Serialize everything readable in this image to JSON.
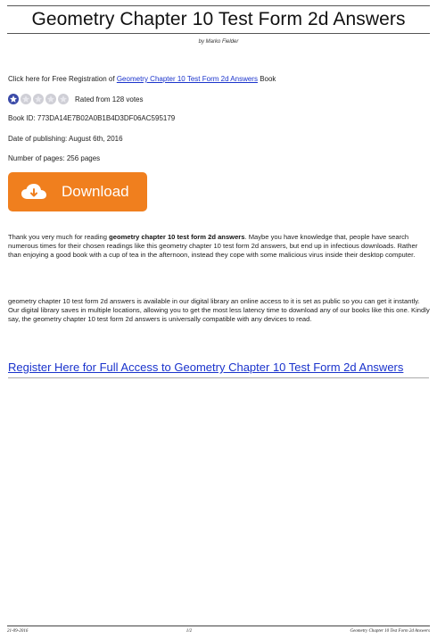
{
  "header": {
    "title": "Geometry Chapter 10 Test Form 2d Answers",
    "byline": "by Marko Fielder"
  },
  "registration": {
    "prefix": "Click here for Free Registration of ",
    "link_text": "Geometry Chapter 10 Test Form 2d Answers",
    "suffix": " Book"
  },
  "rating": {
    "stars_filled": 1,
    "stars_total": 5,
    "text": "Rated from 128 votes"
  },
  "meta": {
    "book_id": "Book ID: 773DA14E7B02A0B1B4D3DF06AC595179",
    "published": "Date of publishing: August 6th, 2016",
    "pages": "Number of pages: 256 pages"
  },
  "download": {
    "label": "Download"
  },
  "body": {
    "p1_prefix": "Thank you very much for reading ",
    "p1_bold": "geometry chapter 10 test form 2d answers",
    "p1_rest": ". Maybe you have knowledge that, people have search numerous times for their chosen readings like this geometry chapter 10 test form 2d answers, but end up in infectious downloads. Rather than enjoying a good book with a cup of tea in the afternoon, instead they cope with some malicious virus inside their desktop computer.",
    "p2": "geometry chapter 10 test form 2d answers is available in our digital library an online access to it is set as public so you can get it instantly. Our digital library saves in multiple locations, allowing you to get the most less latency time to download any of our books like this one. Kindly say, the geometry chapter 10 test form 2d answers is universally compatible with any devices to read."
  },
  "register_link": "Register Here for Full Access to Geometry Chapter 10 Test Form 2d Answers",
  "footer": {
    "date": "21-09-2016",
    "page": "1/2",
    "title": "Geometry Chapter 10 Test Form 2d Answers"
  },
  "colors": {
    "download_bg": "#f07f1e",
    "link": "#1a33cc",
    "star_filled": "#3a4aa8"
  }
}
